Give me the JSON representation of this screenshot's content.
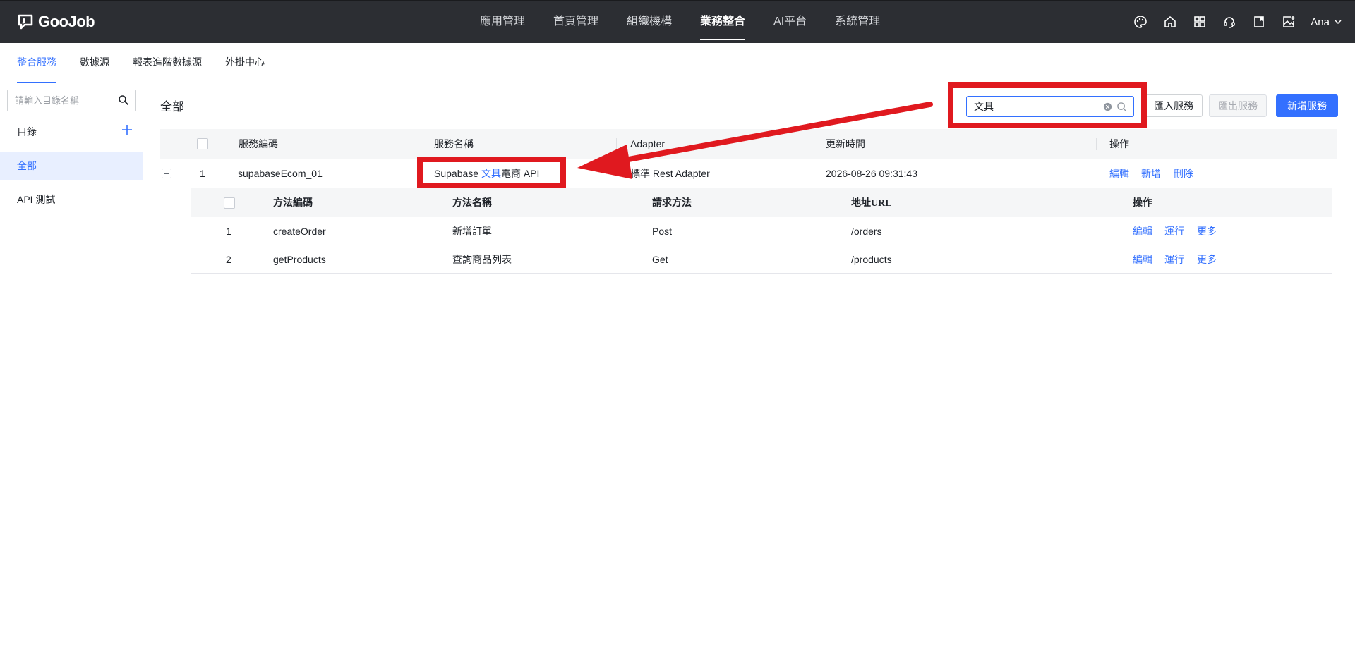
{
  "app": {
    "logo_text": "GooJob"
  },
  "nav": {
    "items": [
      {
        "label": "應用管理",
        "active": false
      },
      {
        "label": "首頁管理",
        "active": false
      },
      {
        "label": "組織機構",
        "active": false
      },
      {
        "label": "業務整合",
        "active": true
      },
      {
        "label": "AI平台",
        "active": false
      },
      {
        "label": "系統管理",
        "active": false
      }
    ]
  },
  "topbar": {
    "icons": [
      "palette-icon",
      "home-icon",
      "apps-grid-icon",
      "headset-icon",
      "book-icon",
      "image-upload-icon"
    ],
    "user_name": "Ana"
  },
  "subtabs": [
    "整合服務",
    "數據源",
    "報表進階數據源",
    "外掛中心"
  ],
  "sidebar": {
    "search_placeholder": "請輸入目錄名稱",
    "heading": "目錄",
    "items": [
      {
        "label": "全部",
        "active": true
      },
      {
        "label": "API 測試",
        "active": false
      }
    ]
  },
  "main": {
    "title": "全部",
    "search_value": "文具",
    "buttons": {
      "import": "匯入服務",
      "export": "匯出服務",
      "add": "新增服務"
    }
  },
  "table": {
    "headers": [
      "服務編碼",
      "服務名稱",
      "Adapter",
      "更新時間",
      "操作"
    ],
    "rows": [
      {
        "index": "1",
        "code": "supabaseEcom_01",
        "name_prefix": "Supabase ",
        "name_highlight": "文具",
        "name_suffix": "電商 API",
        "adapter": "標準 Rest Adapter",
        "updated": "2026-08-26 09:31:43",
        "actions": [
          "編輯",
          "新增",
          "刪除"
        ]
      }
    ]
  },
  "subtable": {
    "headers": [
      "方法編碼",
      "方法名稱",
      "請求方法",
      "地址URL",
      "操作"
    ],
    "rows": [
      {
        "index": "1",
        "code": "createOrder",
        "name": "新增訂單",
        "method": "Post",
        "url": "/orders",
        "actions": [
          "編輯",
          "運行",
          "更多"
        ]
      },
      {
        "index": "2",
        "code": "getProducts",
        "name": "查詢商品列表",
        "method": "Get",
        "url": "/products",
        "actions": [
          "編輯",
          "運行",
          "更多"
        ]
      }
    ]
  },
  "colors": {
    "topbar_bg": "#2c2e33",
    "accent": "#3370ff",
    "annotation_red": "#e0191f"
  }
}
